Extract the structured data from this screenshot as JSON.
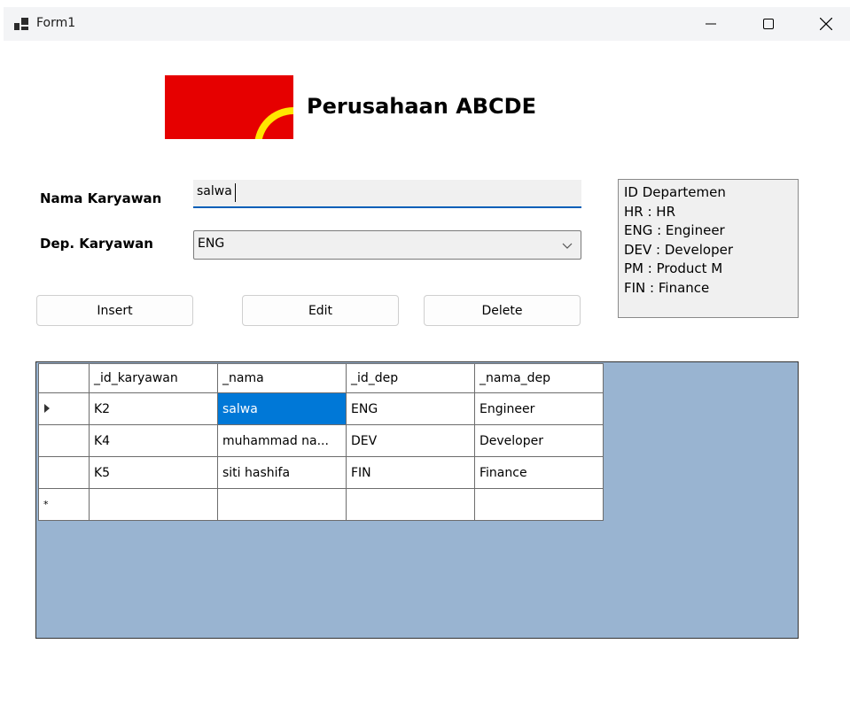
{
  "window": {
    "title": "Form1",
    "icon": "app-icon"
  },
  "header": {
    "company_title": "Perusahaan ABCDE"
  },
  "form": {
    "nama_label": "Nama Karyawan",
    "nama_value": "salwa",
    "dep_label": "Dep. Karyawan",
    "dep_selected": "ENG"
  },
  "info": {
    "lines": [
      "ID Departemen",
      "HR : HR",
      "ENG : Engineer",
      "DEV : Developer",
      "PM : Product M",
      "FIN : Finance"
    ]
  },
  "buttons": {
    "insert": "Insert",
    "edit": "Edit",
    "delete": "Delete"
  },
  "grid": {
    "columns": [
      "_id_karyawan",
      "_nama",
      "_id_dep",
      "_nama_dep"
    ],
    "rows": [
      [
        "K2",
        "salwa",
        "ENG",
        "Engineer"
      ],
      [
        "K4",
        "muhammad na...",
        "DEV",
        "Developer"
      ],
      [
        "K5",
        "siti hashifa",
        "FIN",
        "Finance"
      ]
    ],
    "current_row_marker": "▶",
    "new_row_marker": "*"
  },
  "colors": {
    "accent": "#005fb8",
    "selection": "#0078d7",
    "grid_background": "#99b4d1",
    "logo_red": "#e60000",
    "logo_yellow": "#ffe600"
  }
}
